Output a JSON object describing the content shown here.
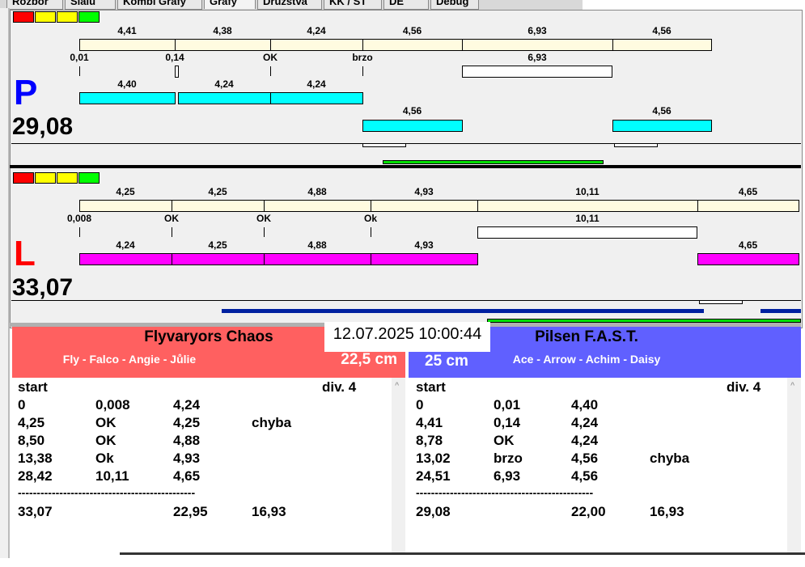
{
  "tabs": [
    "Rozbor",
    "Slalu",
    "Kombi Grafy",
    "Grafy",
    "Družstva",
    "KK / ST",
    "DE",
    "Debug"
  ],
  "active_tab": "Grafy",
  "status_colors": [
    "#ff0000",
    "#ffff00",
    "#ffff00",
    "#00ff00"
  ],
  "colors": {
    "track": "#fffbe0",
    "p_bars": "#00ffff",
    "l_bars": "#ff00ff",
    "green": "#00e000",
    "blue": "#0020a0",
    "team_left": "#ff6060",
    "team_right": "#6060ff"
  },
  "p": {
    "letter": "P",
    "total": "29,08",
    "track": [
      "4,41",
      "4,38",
      "4,24",
      "4,56",
      "6,93",
      "4,56"
    ],
    "marks": [
      "0,01",
      "0,14",
      "OK",
      "brzo",
      "6,93"
    ],
    "row1": [
      "4,40",
      "4,24",
      "4,24"
    ],
    "row2": [
      "4,56",
      "4,56"
    ]
  },
  "l": {
    "letter": "L",
    "total": "33,07",
    "track": [
      "4,25",
      "4,25",
      "4,88",
      "4,93",
      "10,11",
      "4,65"
    ],
    "marks": [
      "0,008",
      "OK",
      "OK",
      "Ok",
      "10,11"
    ],
    "row1": [
      "4,24",
      "4,25",
      "4,88",
      "4,93",
      "4,65"
    ]
  },
  "timestamp": "12.07.2025 10:00:44",
  "left_team": {
    "name": "Flyvaryors Chaos",
    "members": "Fly - Falco - Angie - Jůlie",
    "distance": "22,5 cm",
    "header": [
      "start",
      "div.  4"
    ],
    "rows": [
      [
        "0",
        "0,008",
        "4,24",
        ""
      ],
      [
        "4,25",
        "OK",
        "4,25",
        "chyba"
      ],
      [
        "8,50",
        "OK",
        "4,88",
        ""
      ],
      [
        "13,38",
        "Ok",
        "4,93",
        ""
      ],
      [
        "28,42",
        "10,11",
        "4,65",
        ""
      ]
    ],
    "separator": "-----------------------------------------------",
    "total": [
      "33,07",
      "",
      "22,95",
      "16,93"
    ]
  },
  "right_team": {
    "name": "Pilsen F.A.S.T.",
    "members": "Ace - Arrow - Achim - Daisy",
    "distance": "25 cm",
    "header": [
      "start",
      "div.  4"
    ],
    "rows": [
      [
        "0",
        "0,01",
        "4,40",
        ""
      ],
      [
        "4,41",
        "0,14",
        "4,24",
        ""
      ],
      [
        "8,78",
        "OK",
        "4,24",
        ""
      ],
      [
        "13,02",
        "brzo",
        "4,56",
        "chyba"
      ],
      [
        "24,51",
        "6,93",
        "4,56",
        ""
      ]
    ],
    "separator": "-----------------------------------------------",
    "total": [
      "29,08",
      "",
      "22,00",
      "16,93"
    ]
  }
}
